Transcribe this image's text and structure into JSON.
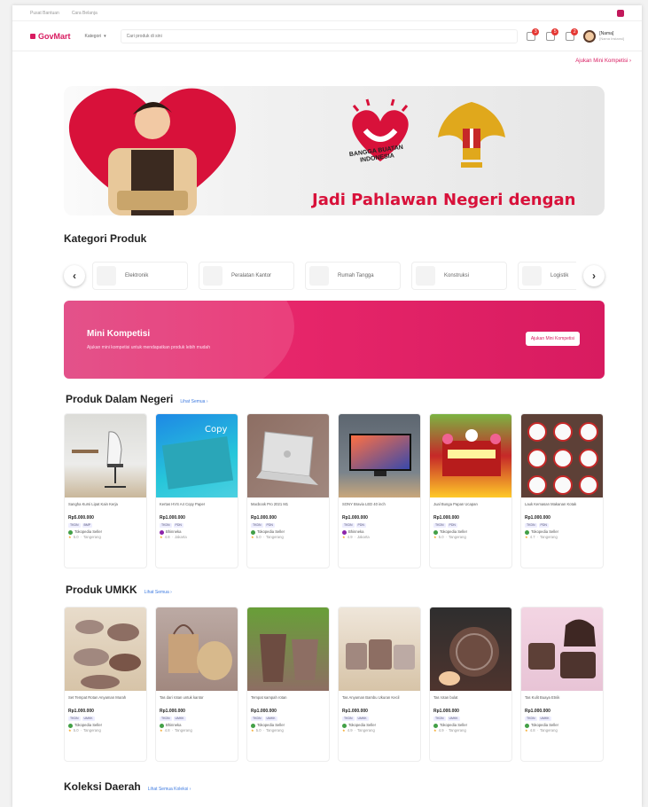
{
  "topbar": {
    "left1": "Pusat Bantuan",
    "left2": "Cara Belanja",
    "icon": "bell-icon"
  },
  "header": {
    "logo": "GovMart",
    "category_dropdown": "Kategori",
    "search_placeholder": "Cari produk di sini",
    "icons": [
      {
        "name": "cart-icon",
        "count": "3"
      },
      {
        "name": "notification-icon",
        "count": "5"
      },
      {
        "name": "chat-icon",
        "count": "2"
      }
    ],
    "user": {
      "name": "[Nama]",
      "role": "[Nama Instansi]"
    }
  },
  "links": {
    "mini_kompetisi_top": "Ajukan Mini Kompetisi"
  },
  "banner": {
    "badge_text": "BANGGA BUATAN INDONESIA",
    "headline": "Jadi Pahlawan Negeri dengan",
    "colors": {
      "red": "#d8113a"
    }
  },
  "kategori": {
    "title": "Kategori Produk",
    "items": [
      "Elektronik",
      "Peralatan Kantor",
      "Rumah Tangga",
      "Konstruksi",
      "Logistik"
    ]
  },
  "mini_kompetisi": {
    "title": "Mini Kompetisi",
    "description": "Ajukan mini kompetisi untuk mendapatkan produk lebih mudah",
    "button": "Ajukan Mini Kompetisi",
    "color": "#d81b60"
  },
  "produk_dalam_negeri": {
    "title": "Produk Dalam Negeri",
    "see_all": "Lihat Semua",
    "items": [
      {
        "name": "Sangha Kursi Lipat Kain Kerja",
        "price": "Rp5.000.000",
        "tags": [
          "TKDN",
          "BMP"
        ],
        "seller": "Tokopedia Seller",
        "rating": "5.0",
        "location": "Tangerang",
        "seller_color": "#43a047"
      },
      {
        "name": "Kertas HVS A4 Copy Paper",
        "price": "Rp1.000.000",
        "tags": [
          "TKDN",
          "PDN"
        ],
        "seller": "Bhinneka",
        "rating": "4.8",
        "location": "Jakarta",
        "seller_color": "#8e24aa"
      },
      {
        "name": "Macbook Pro 2021 M1",
        "price": "Rp1.000.000",
        "tags": [
          "TKDN",
          "PDN"
        ],
        "seller": "Tokopedia Seller",
        "rating": "5.0",
        "location": "Tangerang",
        "seller_color": "#43a047"
      },
      {
        "name": "SONY Bravia LED 40 inch",
        "price": "Rp1.000.000",
        "tags": [
          "TKDN",
          "PDN"
        ],
        "seller": "Bhinneka",
        "rating": "4.9",
        "location": "Jakarta",
        "seller_color": "#8e24aa"
      },
      {
        "name": "Jual Bunga Papan Ucapan",
        "price": "Rp1.000.000",
        "tags": [
          "TKDN",
          "PDN"
        ],
        "seller": "Tokopedia Seller",
        "rating": "5.0",
        "location": "Tangerang",
        "seller_color": "#43a047"
      },
      {
        "name": "Lauk Kemasan Makanan Kotak",
        "price": "Rp1.000.000",
        "tags": [
          "TKDN",
          "PDN"
        ],
        "seller": "Tokopedia Seller",
        "rating": "4.7",
        "location": "Tangerang",
        "seller_color": "#43a047"
      }
    ]
  },
  "produk_umkk": {
    "title": "Produk UMKK",
    "see_all": "Lihat Semua",
    "items": [
      {
        "name": "Set Tempat Rotan Anyaman Murah",
        "price": "Rp1.000.000",
        "tags": [
          "TKDN",
          "UMKK"
        ],
        "seller": "Tokopedia Seller",
        "rating": "5.0",
        "location": "Tangerang",
        "seller_color": "#43a047"
      },
      {
        "name": "Tas dari rotan untuk kantor",
        "price": "Rp1.000.000",
        "tags": [
          "TKDN",
          "UMKK"
        ],
        "seller": "Bhinneka",
        "rating": "4.8",
        "location": "Tangerang",
        "seller_color": "#43a047"
      },
      {
        "name": "Tempat sampah rotan",
        "price": "Rp1.000.000",
        "tags": [
          "TKDN",
          "UMKK"
        ],
        "seller": "Tokopedia Seller",
        "rating": "5.0",
        "location": "Tangerang",
        "seller_color": "#43a047"
      },
      {
        "name": "Tas Anyaman Bambu Ukuran Kecil",
        "price": "Rp1.000.000",
        "tags": [
          "TKDN",
          "UMKK"
        ],
        "seller": "Tokopedia Seller",
        "rating": "4.9",
        "location": "Tangerang",
        "seller_color": "#43a047"
      },
      {
        "name": "Tas rotan bulat",
        "price": "Rp1.000.000",
        "tags": [
          "TKDN",
          "UMKK"
        ],
        "seller": "Tokopedia Seller",
        "rating": "4.9",
        "location": "Tangerang",
        "seller_color": "#43a047"
      },
      {
        "name": "Tas Kulit Buaya Etnik",
        "price": "Rp1.000.000",
        "tags": [
          "TKDN",
          "UMKK"
        ],
        "seller": "Tokopedia Seller",
        "rating": "4.8",
        "location": "Tangerang",
        "seller_color": "#43a047"
      }
    ]
  },
  "koleksi_daerah": {
    "title": "Koleksi Daerah",
    "see_all": "Lihat Semua Koleksi"
  }
}
